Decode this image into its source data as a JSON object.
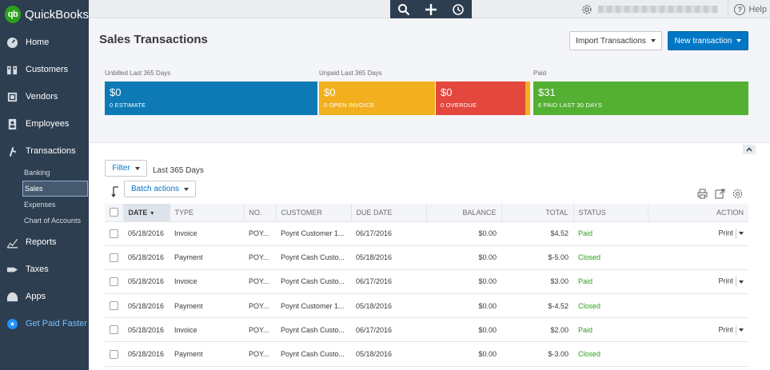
{
  "app": {
    "logo_mark": "qb",
    "logo_name": "QuickBooks"
  },
  "topbar": {
    "help_label": "Help",
    "icons": [
      "search-icon",
      "plus-icon",
      "recent-icon",
      "gear-icon",
      "help-icon"
    ]
  },
  "sidebar": {
    "items": [
      {
        "label": "Home",
        "icon": "dashboard-icon"
      },
      {
        "label": "Customers",
        "icon": "customers-icon"
      },
      {
        "label": "Vendors",
        "icon": "vendors-icon"
      },
      {
        "label": "Employees",
        "icon": "employees-icon"
      },
      {
        "label": "Transactions",
        "icon": "transactions-icon"
      }
    ],
    "sub_items": [
      "Banking",
      "Sales",
      "Expenses",
      "Chart of Accounts"
    ],
    "bottom_items": [
      {
        "label": "Reports",
        "icon": "reports-icon"
      },
      {
        "label": "Taxes",
        "icon": "taxes-icon"
      },
      {
        "label": "Apps",
        "icon": "apps-icon"
      },
      {
        "label": "Get Paid Faster",
        "icon": "star-icon"
      }
    ]
  },
  "header": {
    "title": "Sales Transactions",
    "import_label": "Import Transactions",
    "new_label": "New transaction"
  },
  "money_bar": {
    "unbilled_label": "Unbilled Last 365 Days",
    "unpaid_label": "Unpaid Last 365 Days",
    "paid_label": "Paid",
    "segments": [
      {
        "amount": "$0",
        "caption": "0 ESTIMATE",
        "color": "#0d7ab5"
      },
      {
        "amount": "$0",
        "caption": "0 OPEN INVOICE",
        "color": "#f2b01e"
      },
      {
        "amount": "$0",
        "caption": "0 OVERDUE",
        "color": "#e4473e"
      },
      {
        "amount": "$31",
        "caption": "6 PAID LAST 30 DAYS",
        "color": "#53b033"
      }
    ]
  },
  "toolbar": {
    "filter_label": "Filter",
    "range_label": "Last 365 Days",
    "batch_label": "Batch actions"
  },
  "table": {
    "columns": [
      "DATE",
      "TYPE",
      "NO.",
      "CUSTOMER",
      "DUE DATE",
      "BALANCE",
      "TOTAL",
      "STATUS",
      "ACTION"
    ],
    "rows": [
      {
        "date": "05/18/2016",
        "type": "Invoice",
        "no": "POY...",
        "customer": "Poynt Customer 1...",
        "due": "06/17/2016",
        "balance": "$0.00",
        "total": "$4.52",
        "status": "Paid",
        "action": "Print"
      },
      {
        "date": "05/18/2016",
        "type": "Payment",
        "no": "POY...",
        "customer": "Poynt Cash Custo...",
        "due": "05/18/2016",
        "balance": "$0.00",
        "total": "$-5.00",
        "status": "Closed",
        "action": ""
      },
      {
        "date": "05/18/2016",
        "type": "Invoice",
        "no": "POY...",
        "customer": "Poynt Cash Custo...",
        "due": "06/17/2016",
        "balance": "$0.00",
        "total": "$3.00",
        "status": "Paid",
        "action": "Print"
      },
      {
        "date": "05/18/2016",
        "type": "Payment",
        "no": "POY...",
        "customer": "Poynt Customer 1...",
        "due": "05/18/2016",
        "balance": "$0.00",
        "total": "$-4.52",
        "status": "Closed",
        "action": ""
      },
      {
        "date": "05/18/2016",
        "type": "Invoice",
        "no": "POY...",
        "customer": "Poynt Cash Custo...",
        "due": "06/17/2016",
        "balance": "$0.00",
        "total": "$2.00",
        "status": "Paid",
        "action": "Print"
      },
      {
        "date": "05/18/2016",
        "type": "Payment",
        "no": "POY...",
        "customer": "Poynt Cash Custo...",
        "due": "05/18/2016",
        "balance": "$0.00",
        "total": "$-3.00",
        "status": "Closed",
        "action": ""
      }
    ]
  }
}
